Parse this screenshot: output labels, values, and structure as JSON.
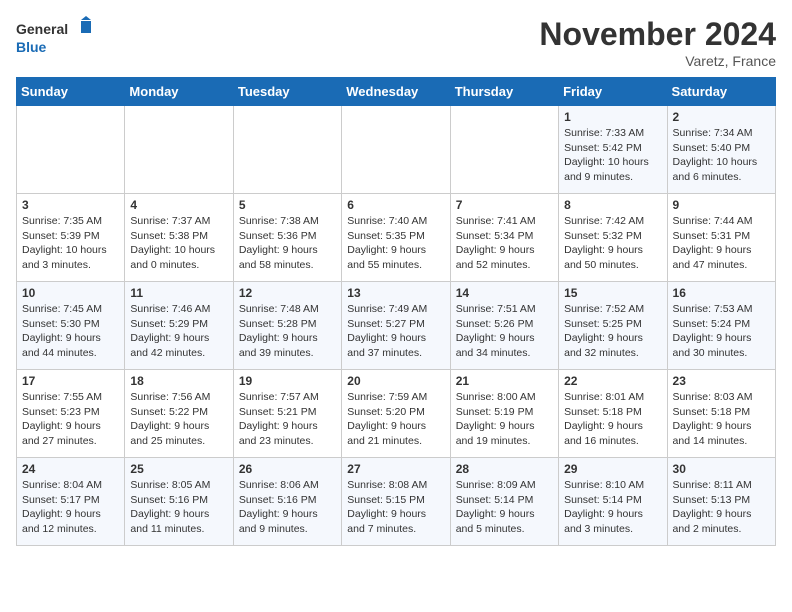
{
  "logo": {
    "line1": "General",
    "line2": "Blue"
  },
  "title": "November 2024",
  "subtitle": "Varetz, France",
  "days_header": [
    "Sunday",
    "Monday",
    "Tuesday",
    "Wednesday",
    "Thursday",
    "Friday",
    "Saturday"
  ],
  "weeks": [
    [
      {
        "day": "",
        "sunrise": "",
        "sunset": "",
        "daylight": ""
      },
      {
        "day": "",
        "sunrise": "",
        "sunset": "",
        "daylight": ""
      },
      {
        "day": "",
        "sunrise": "",
        "sunset": "",
        "daylight": ""
      },
      {
        "day": "",
        "sunrise": "",
        "sunset": "",
        "daylight": ""
      },
      {
        "day": "",
        "sunrise": "",
        "sunset": "",
        "daylight": ""
      },
      {
        "day": "1",
        "sunrise": "Sunrise: 7:33 AM",
        "sunset": "Sunset: 5:42 PM",
        "daylight": "Daylight: 10 hours and 9 minutes."
      },
      {
        "day": "2",
        "sunrise": "Sunrise: 7:34 AM",
        "sunset": "Sunset: 5:40 PM",
        "daylight": "Daylight: 10 hours and 6 minutes."
      }
    ],
    [
      {
        "day": "3",
        "sunrise": "Sunrise: 7:35 AM",
        "sunset": "Sunset: 5:39 PM",
        "daylight": "Daylight: 10 hours and 3 minutes."
      },
      {
        "day": "4",
        "sunrise": "Sunrise: 7:37 AM",
        "sunset": "Sunset: 5:38 PM",
        "daylight": "Daylight: 10 hours and 0 minutes."
      },
      {
        "day": "5",
        "sunrise": "Sunrise: 7:38 AM",
        "sunset": "Sunset: 5:36 PM",
        "daylight": "Daylight: 9 hours and 58 minutes."
      },
      {
        "day": "6",
        "sunrise": "Sunrise: 7:40 AM",
        "sunset": "Sunset: 5:35 PM",
        "daylight": "Daylight: 9 hours and 55 minutes."
      },
      {
        "day": "7",
        "sunrise": "Sunrise: 7:41 AM",
        "sunset": "Sunset: 5:34 PM",
        "daylight": "Daylight: 9 hours and 52 minutes."
      },
      {
        "day": "8",
        "sunrise": "Sunrise: 7:42 AM",
        "sunset": "Sunset: 5:32 PM",
        "daylight": "Daylight: 9 hours and 50 minutes."
      },
      {
        "day": "9",
        "sunrise": "Sunrise: 7:44 AM",
        "sunset": "Sunset: 5:31 PM",
        "daylight": "Daylight: 9 hours and 47 minutes."
      }
    ],
    [
      {
        "day": "10",
        "sunrise": "Sunrise: 7:45 AM",
        "sunset": "Sunset: 5:30 PM",
        "daylight": "Daylight: 9 hours and 44 minutes."
      },
      {
        "day": "11",
        "sunrise": "Sunrise: 7:46 AM",
        "sunset": "Sunset: 5:29 PM",
        "daylight": "Daylight: 9 hours and 42 minutes."
      },
      {
        "day": "12",
        "sunrise": "Sunrise: 7:48 AM",
        "sunset": "Sunset: 5:28 PM",
        "daylight": "Daylight: 9 hours and 39 minutes."
      },
      {
        "day": "13",
        "sunrise": "Sunrise: 7:49 AM",
        "sunset": "Sunset: 5:27 PM",
        "daylight": "Daylight: 9 hours and 37 minutes."
      },
      {
        "day": "14",
        "sunrise": "Sunrise: 7:51 AM",
        "sunset": "Sunset: 5:26 PM",
        "daylight": "Daylight: 9 hours and 34 minutes."
      },
      {
        "day": "15",
        "sunrise": "Sunrise: 7:52 AM",
        "sunset": "Sunset: 5:25 PM",
        "daylight": "Daylight: 9 hours and 32 minutes."
      },
      {
        "day": "16",
        "sunrise": "Sunrise: 7:53 AM",
        "sunset": "Sunset: 5:24 PM",
        "daylight": "Daylight: 9 hours and 30 minutes."
      }
    ],
    [
      {
        "day": "17",
        "sunrise": "Sunrise: 7:55 AM",
        "sunset": "Sunset: 5:23 PM",
        "daylight": "Daylight: 9 hours and 27 minutes."
      },
      {
        "day": "18",
        "sunrise": "Sunrise: 7:56 AM",
        "sunset": "Sunset: 5:22 PM",
        "daylight": "Daylight: 9 hours and 25 minutes."
      },
      {
        "day": "19",
        "sunrise": "Sunrise: 7:57 AM",
        "sunset": "Sunset: 5:21 PM",
        "daylight": "Daylight: 9 hours and 23 minutes."
      },
      {
        "day": "20",
        "sunrise": "Sunrise: 7:59 AM",
        "sunset": "Sunset: 5:20 PM",
        "daylight": "Daylight: 9 hours and 21 minutes."
      },
      {
        "day": "21",
        "sunrise": "Sunrise: 8:00 AM",
        "sunset": "Sunset: 5:19 PM",
        "daylight": "Daylight: 9 hours and 19 minutes."
      },
      {
        "day": "22",
        "sunrise": "Sunrise: 8:01 AM",
        "sunset": "Sunset: 5:18 PM",
        "daylight": "Daylight: 9 hours and 16 minutes."
      },
      {
        "day": "23",
        "sunrise": "Sunrise: 8:03 AM",
        "sunset": "Sunset: 5:18 PM",
        "daylight": "Daylight: 9 hours and 14 minutes."
      }
    ],
    [
      {
        "day": "24",
        "sunrise": "Sunrise: 8:04 AM",
        "sunset": "Sunset: 5:17 PM",
        "daylight": "Daylight: 9 hours and 12 minutes."
      },
      {
        "day": "25",
        "sunrise": "Sunrise: 8:05 AM",
        "sunset": "Sunset: 5:16 PM",
        "daylight": "Daylight: 9 hours and 11 minutes."
      },
      {
        "day": "26",
        "sunrise": "Sunrise: 8:06 AM",
        "sunset": "Sunset: 5:16 PM",
        "daylight": "Daylight: 9 hours and 9 minutes."
      },
      {
        "day": "27",
        "sunrise": "Sunrise: 8:08 AM",
        "sunset": "Sunset: 5:15 PM",
        "daylight": "Daylight: 9 hours and 7 minutes."
      },
      {
        "day": "28",
        "sunrise": "Sunrise: 8:09 AM",
        "sunset": "Sunset: 5:14 PM",
        "daylight": "Daylight: 9 hours and 5 minutes."
      },
      {
        "day": "29",
        "sunrise": "Sunrise: 8:10 AM",
        "sunset": "Sunset: 5:14 PM",
        "daylight": "Daylight: 9 hours and 3 minutes."
      },
      {
        "day": "30",
        "sunrise": "Sunrise: 8:11 AM",
        "sunset": "Sunset: 5:13 PM",
        "daylight": "Daylight: 9 hours and 2 minutes."
      }
    ]
  ]
}
